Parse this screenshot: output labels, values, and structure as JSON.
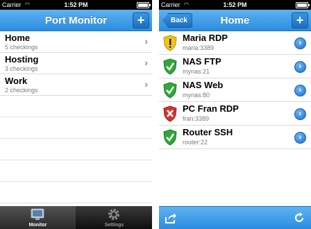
{
  "left": {
    "status": {
      "carrier": "Carrier",
      "time": "1:52 PM"
    },
    "nav": {
      "title": "Port Monitor",
      "add_label": "+"
    },
    "groups": [
      {
        "name": "Home",
        "detail": "5 checkings"
      },
      {
        "name": "Hosting",
        "detail": "3 checkings"
      },
      {
        "name": "Work",
        "detail": "2 checkings"
      }
    ],
    "tabs": [
      {
        "label": "Monitor",
        "icon": "monitor-icon",
        "active": true
      },
      {
        "label": "Settings",
        "icon": "gear-icon",
        "active": false
      }
    ]
  },
  "right": {
    "status": {
      "carrier": "Carrier",
      "time": "1:52 PM"
    },
    "nav": {
      "title": "Home",
      "back_label": "Back",
      "add_label": "+"
    },
    "checks": [
      {
        "name": "Maria RDP",
        "address": "maria:3389",
        "status": "warning",
        "icon": "shield-warning-icon"
      },
      {
        "name": "NAS FTP",
        "address": "mynas:21",
        "status": "ok",
        "icon": "shield-check-icon"
      },
      {
        "name": "NAS Web",
        "address": "mynas:80",
        "status": "ok",
        "icon": "shield-check-icon"
      },
      {
        "name": "PC Fran RDP",
        "address": "fran:3389",
        "status": "error",
        "icon": "shield-error-icon"
      },
      {
        "name": "Router SSH",
        "address": "router:22",
        "status": "ok",
        "icon": "shield-check-icon"
      }
    ],
    "toolbar": {
      "share_icon": "share-icon",
      "refresh_icon": "refresh-icon"
    }
  },
  "colors": {
    "accent": "#2a8de0",
    "ok": "#2fa83a",
    "warning": "#f0c21a",
    "error": "#d3322b"
  }
}
